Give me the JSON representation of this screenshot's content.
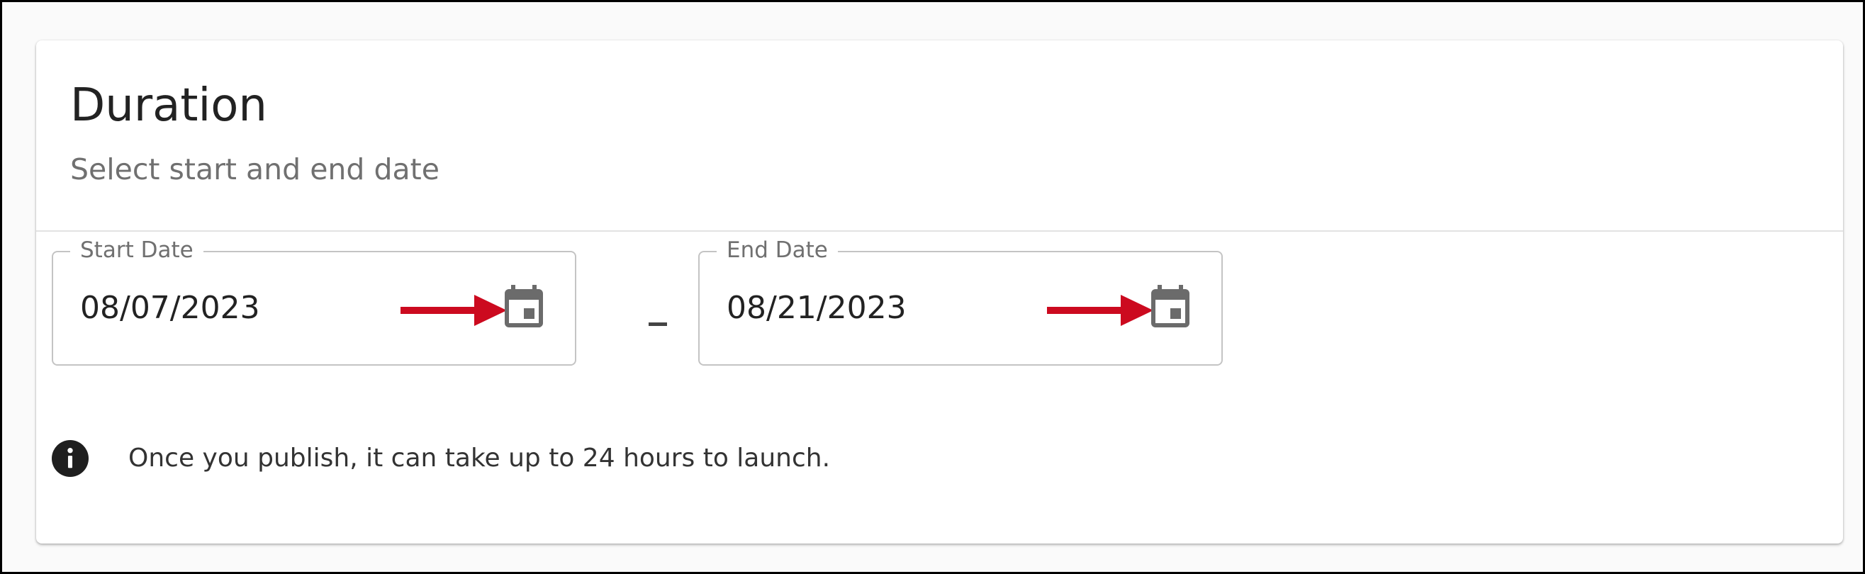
{
  "colors": {
    "page_background": "#fafafa",
    "frame_border": "#000000",
    "card_background": "#ffffff",
    "title_text": "#222222",
    "subtitle_text": "#707070",
    "outline": "#c4c4c4",
    "icon": "#6b6b6b",
    "annotation_arrow": "#cc0a1f"
  },
  "duration": {
    "title": "Duration",
    "subtitle": "Select start and end date"
  },
  "start_date": {
    "label": "Start Date",
    "value": "08/07/2023",
    "icon": "calendar-icon"
  },
  "range_separator": "–",
  "end_date": {
    "label": "End Date",
    "value": "08/21/2023",
    "icon": "calendar-icon"
  },
  "notice": {
    "icon": "info-icon",
    "text": "Once you publish, it can take up to 24 hours to launch."
  }
}
